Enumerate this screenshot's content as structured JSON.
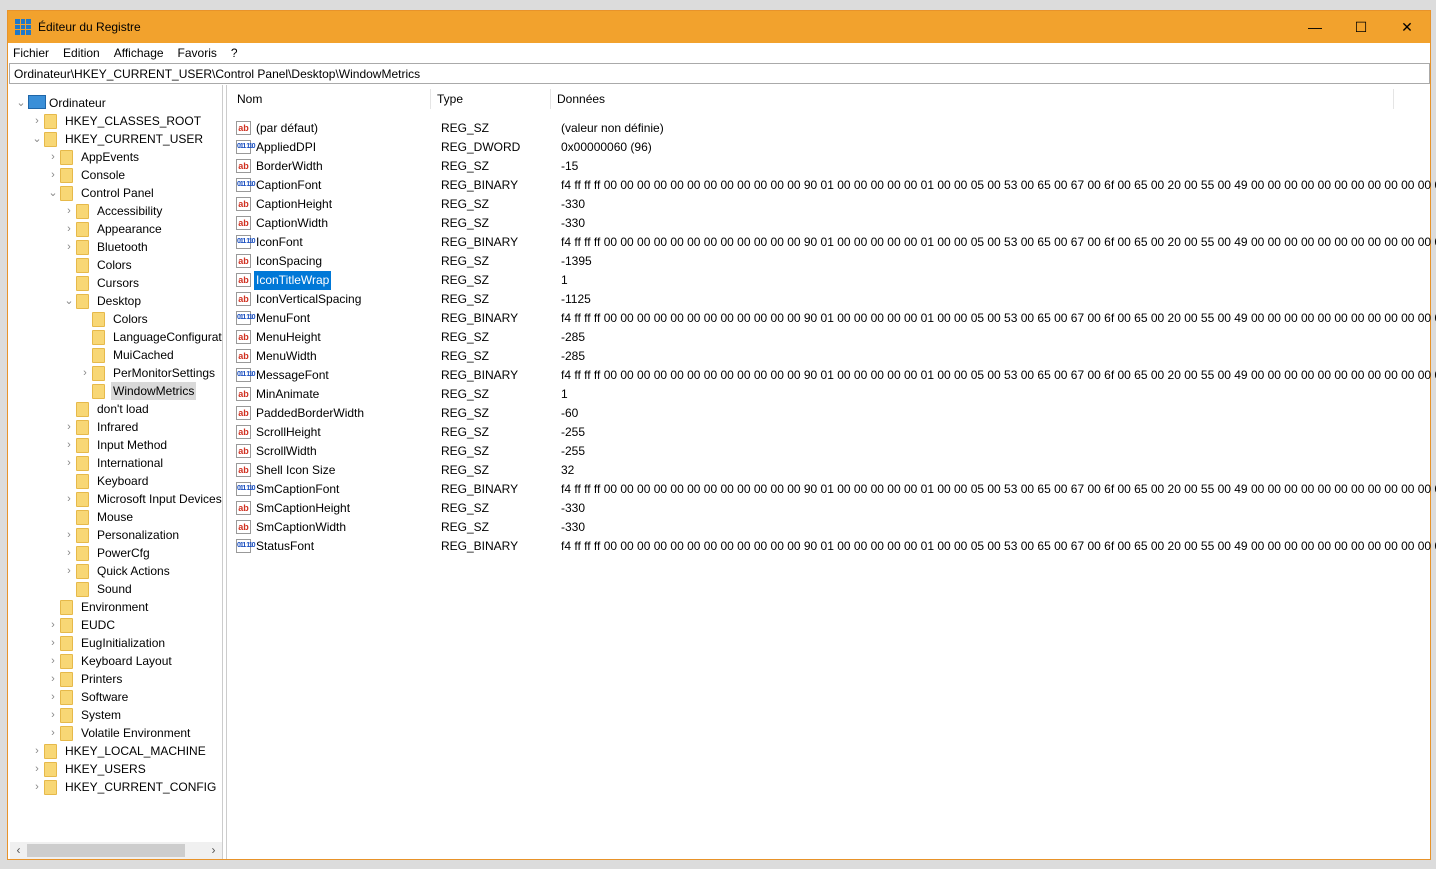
{
  "window": {
    "title": "Éditeur du Registre",
    "minimize": "—",
    "maximize": "☐",
    "close": "✕",
    "accent": "#f2a22d"
  },
  "menu": [
    "Fichier",
    "Edition",
    "Affichage",
    "Favoris",
    "?"
  ],
  "address": "Ordinateur\\HKEY_CURRENT_USER\\Control Panel\\Desktop\\WindowMetrics",
  "tree": [
    {
      "label": "Ordinateur",
      "level": 0,
      "exp": "open",
      "root": true
    },
    {
      "label": "HKEY_CLASSES_ROOT",
      "level": 1,
      "exp": "closed"
    },
    {
      "label": "HKEY_CURRENT_USER",
      "level": 1,
      "exp": "open"
    },
    {
      "label": "AppEvents",
      "level": 2,
      "exp": "closed"
    },
    {
      "label": "Console",
      "level": 2,
      "exp": "closed"
    },
    {
      "label": "Control Panel",
      "level": 2,
      "exp": "open"
    },
    {
      "label": "Accessibility",
      "level": 3,
      "exp": "closed"
    },
    {
      "label": "Appearance",
      "level": 3,
      "exp": "closed"
    },
    {
      "label": "Bluetooth",
      "level": 3,
      "exp": "closed"
    },
    {
      "label": "Colors",
      "level": 3,
      "exp": "none"
    },
    {
      "label": "Cursors",
      "level": 3,
      "exp": "none"
    },
    {
      "label": "Desktop",
      "level": 3,
      "exp": "open"
    },
    {
      "label": "Colors",
      "level": 4,
      "exp": "none"
    },
    {
      "label": "LanguageConfigurat",
      "level": 4,
      "exp": "none"
    },
    {
      "label": "MuiCached",
      "level": 4,
      "exp": "none"
    },
    {
      "label": "PerMonitorSettings",
      "level": 4,
      "exp": "closed"
    },
    {
      "label": "WindowMetrics",
      "level": 4,
      "exp": "none",
      "selected": true
    },
    {
      "label": "don't load",
      "level": 3,
      "exp": "none"
    },
    {
      "label": "Infrared",
      "level": 3,
      "exp": "closed"
    },
    {
      "label": "Input Method",
      "level": 3,
      "exp": "closed"
    },
    {
      "label": "International",
      "level": 3,
      "exp": "closed"
    },
    {
      "label": "Keyboard",
      "level": 3,
      "exp": "none"
    },
    {
      "label": "Microsoft Input Devices",
      "level": 3,
      "exp": "closed"
    },
    {
      "label": "Mouse",
      "level": 3,
      "exp": "none"
    },
    {
      "label": "Personalization",
      "level": 3,
      "exp": "closed"
    },
    {
      "label": "PowerCfg",
      "level": 3,
      "exp": "closed"
    },
    {
      "label": "Quick Actions",
      "level": 3,
      "exp": "closed"
    },
    {
      "label": "Sound",
      "level": 3,
      "exp": "none"
    },
    {
      "label": "Environment",
      "level": 2,
      "exp": "none"
    },
    {
      "label": "EUDC",
      "level": 2,
      "exp": "closed"
    },
    {
      "label": "EugInitialization",
      "level": 2,
      "exp": "closed"
    },
    {
      "label": "Keyboard Layout",
      "level": 2,
      "exp": "closed"
    },
    {
      "label": "Printers",
      "level": 2,
      "exp": "closed"
    },
    {
      "label": "Software",
      "level": 2,
      "exp": "closed"
    },
    {
      "label": "System",
      "level": 2,
      "exp": "closed"
    },
    {
      "label": "Volatile Environment",
      "level": 2,
      "exp": "closed"
    },
    {
      "label": "HKEY_LOCAL_MACHINE",
      "level": 1,
      "exp": "closed"
    },
    {
      "label": "HKEY_USERS",
      "level": 1,
      "exp": "closed"
    },
    {
      "label": "HKEY_CURRENT_CONFIG",
      "level": 1,
      "exp": "closed"
    }
  ],
  "columns": {
    "name": "Nom",
    "type": "Type",
    "data": "Données"
  },
  "values": [
    {
      "name": "(par défaut)",
      "type": "REG_SZ",
      "data": "(valeur non définie)",
      "icon": "ab"
    },
    {
      "name": "AppliedDPI",
      "type": "REG_DWORD",
      "data": "0x00000060 (96)",
      "icon": "bin"
    },
    {
      "name": "BorderWidth",
      "type": "REG_SZ",
      "data": "-15",
      "icon": "ab"
    },
    {
      "name": "CaptionFont",
      "type": "REG_BINARY",
      "data": "f4 ff ff ff 00 00 00 00 00 00 00 00 00 00 00 00 90 01 00 00 00 00 00 01 00 00 05 00 53 00 65 00 67 00 6f 00 65 00 20 00 55 00 49 00 00 00 00 00 00 00 00 00 00 00 00 00...",
      "icon": "bin"
    },
    {
      "name": "CaptionHeight",
      "type": "REG_SZ",
      "data": "-330",
      "icon": "ab"
    },
    {
      "name": "CaptionWidth",
      "type": "REG_SZ",
      "data": "-330",
      "icon": "ab"
    },
    {
      "name": "IconFont",
      "type": "REG_BINARY",
      "data": "f4 ff ff ff 00 00 00 00 00 00 00 00 00 00 00 00 90 01 00 00 00 00 00 01 00 00 05 00 53 00 65 00 67 00 6f 00 65 00 20 00 55 00 49 00 00 00 00 00 00 00 00 00 00 00 00 00...",
      "icon": "bin"
    },
    {
      "name": "IconSpacing",
      "type": "REG_SZ",
      "data": "-1395",
      "icon": "ab"
    },
    {
      "name": "IconTitleWrap",
      "type": "REG_SZ",
      "data": "1",
      "icon": "ab",
      "selected": true
    },
    {
      "name": "IconVerticalSpacing",
      "type": "REG_SZ",
      "data": "-1125",
      "icon": "ab"
    },
    {
      "name": "MenuFont",
      "type": "REG_BINARY",
      "data": "f4 ff ff ff 00 00 00 00 00 00 00 00 00 00 00 00 90 01 00 00 00 00 00 01 00 00 05 00 53 00 65 00 67 00 6f 00 65 00 20 00 55 00 49 00 00 00 00 00 00 00 00 00 00 00 00 00...",
      "icon": "bin"
    },
    {
      "name": "MenuHeight",
      "type": "REG_SZ",
      "data": "-285",
      "icon": "ab"
    },
    {
      "name": "MenuWidth",
      "type": "REG_SZ",
      "data": "-285",
      "icon": "ab"
    },
    {
      "name": "MessageFont",
      "type": "REG_BINARY",
      "data": "f4 ff ff ff 00 00 00 00 00 00 00 00 00 00 00 00 90 01 00 00 00 00 00 01 00 00 05 00 53 00 65 00 67 00 6f 00 65 00 20 00 55 00 49 00 00 00 00 00 00 00 00 00 00 00 00 00...",
      "icon": "bin"
    },
    {
      "name": "MinAnimate",
      "type": "REG_SZ",
      "data": "1",
      "icon": "ab"
    },
    {
      "name": "PaddedBorderWidth",
      "type": "REG_SZ",
      "data": "-60",
      "icon": "ab"
    },
    {
      "name": "ScrollHeight",
      "type": "REG_SZ",
      "data": "-255",
      "icon": "ab"
    },
    {
      "name": "ScrollWidth",
      "type": "REG_SZ",
      "data": "-255",
      "icon": "ab"
    },
    {
      "name": "Shell Icon Size",
      "type": "REG_SZ",
      "data": "32",
      "icon": "ab"
    },
    {
      "name": "SmCaptionFont",
      "type": "REG_BINARY",
      "data": "f4 ff ff ff 00 00 00 00 00 00 00 00 00 00 00 00 90 01 00 00 00 00 00 01 00 00 05 00 53 00 65 00 67 00 6f 00 65 00 20 00 55 00 49 00 00 00 00 00 00 00 00 00 00 00 00 00...",
      "icon": "bin"
    },
    {
      "name": "SmCaptionHeight",
      "type": "REG_SZ",
      "data": "-330",
      "icon": "ab"
    },
    {
      "name": "SmCaptionWidth",
      "type": "REG_SZ",
      "data": "-330",
      "icon": "ab"
    },
    {
      "name": "StatusFont",
      "type": "REG_BINARY",
      "data": "f4 ff ff ff 00 00 00 00 00 00 00 00 00 00 00 00 90 01 00 00 00 00 00 01 00 00 05 00 53 00 65 00 67 00 6f 00 65 00 20 00 55 00 49 00 00 00 00 00 00 00 00 00 00 00 00 00...",
      "icon": "bin"
    }
  ],
  "icons": {
    "ab": "ab",
    "bin": "011 110"
  }
}
